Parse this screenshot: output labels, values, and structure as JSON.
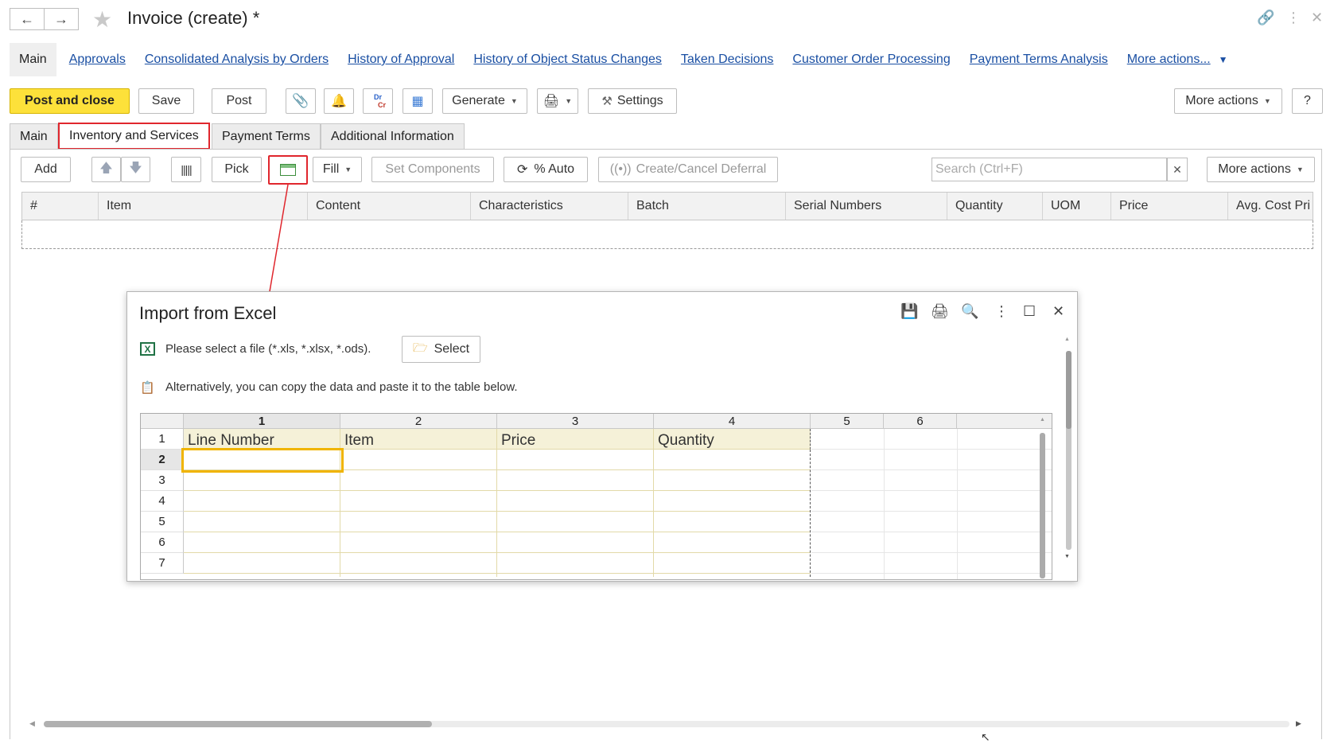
{
  "window": {
    "title": "Invoice (create) *"
  },
  "links": {
    "main": "Main",
    "items": [
      "Approvals",
      "Consolidated Analysis by Orders",
      "History of Approval",
      "History of Object Status Changes",
      "Taken Decisions",
      "Customer Order Processing",
      "Payment Terms Analysis",
      "More actions..."
    ]
  },
  "toolbar": {
    "post_and_close": "Post and close",
    "save": "Save",
    "post": "Post",
    "dr": "Dr",
    "cr": "Cr",
    "generate": "Generate",
    "settings": "Settings",
    "more_actions": "More actions",
    "help": "?"
  },
  "tabs": [
    "Main",
    "Inventory and Services",
    "Payment Terms",
    "Additional Information"
  ],
  "table_toolbar": {
    "add": "Add",
    "pick": "Pick",
    "fill": "Fill",
    "set_components": "Set Components",
    "auto": "% Auto",
    "create_cancel_deferral": "Create/Cancel Deferral",
    "search_placeholder": "Search (Ctrl+F)",
    "more_actions": "More actions"
  },
  "grid": {
    "columns": [
      "#",
      "Item",
      "Content",
      "Characteristics",
      "Batch",
      "Serial Numbers",
      "Quantity",
      "UOM",
      "Price",
      "Avg. Cost Pri"
    ]
  },
  "dialog": {
    "title": "Import from Excel",
    "file_prompt": "Please select a file (*.xls, *.xlsx, *.ods).",
    "select_button": "Select",
    "paste_hint": "Alternatively, you can copy the data and paste it to the table below.",
    "sheet": {
      "col_headers": [
        "1",
        "2",
        "3",
        "4",
        "5",
        "6"
      ],
      "row_headers": [
        "1",
        "2",
        "3",
        "4",
        "5",
        "6",
        "7"
      ],
      "header_row": [
        "Line Number",
        "Item",
        "Price",
        "Quantity"
      ]
    }
  },
  "colors": {
    "accent_yellow": "#fde13a",
    "link_blue": "#1a4fa3",
    "highlight_red": "#e0262d",
    "sheet_header_bg": "#f5f1d8",
    "selected_cell_border": "#f0b400"
  }
}
